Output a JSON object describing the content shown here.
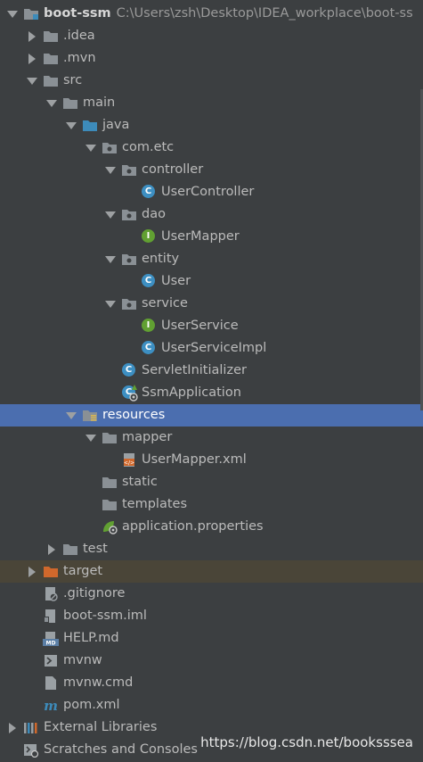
{
  "project": {
    "name": "boot-ssm",
    "path": "C:\\Users\\zsh\\Desktop\\IDEA_workplace\\boot-ss"
  },
  "tree": [
    {
      "label": "boot-ssm",
      "kind": "module-root",
      "depth": 0,
      "arrow": "down"
    },
    {
      "label": ".idea",
      "kind": "folder",
      "depth": 1,
      "arrow": "right"
    },
    {
      "label": ".mvn",
      "kind": "folder",
      "depth": 1,
      "arrow": "right"
    },
    {
      "label": "src",
      "kind": "folder",
      "depth": 1,
      "arrow": "down"
    },
    {
      "label": "main",
      "kind": "folder",
      "depth": 2,
      "arrow": "down"
    },
    {
      "label": "java",
      "kind": "source-folder",
      "depth": 3,
      "arrow": "down"
    },
    {
      "label": "com.etc",
      "kind": "package",
      "depth": 4,
      "arrow": "down"
    },
    {
      "label": "controller",
      "kind": "package",
      "depth": 5,
      "arrow": "down"
    },
    {
      "label": "UserController",
      "kind": "class",
      "depth": 6,
      "arrow": ""
    },
    {
      "label": "dao",
      "kind": "package",
      "depth": 5,
      "arrow": "down"
    },
    {
      "label": "UserMapper",
      "kind": "interface",
      "depth": 6,
      "arrow": ""
    },
    {
      "label": "entity",
      "kind": "package",
      "depth": 5,
      "arrow": "down"
    },
    {
      "label": "User",
      "kind": "class",
      "depth": 6,
      "arrow": ""
    },
    {
      "label": "service",
      "kind": "package",
      "depth": 5,
      "arrow": "down"
    },
    {
      "label": "UserService",
      "kind": "interface",
      "depth": 6,
      "arrow": ""
    },
    {
      "label": "UserServiceImpl",
      "kind": "class",
      "depth": 6,
      "arrow": ""
    },
    {
      "label": "ServletInitializer",
      "kind": "class",
      "depth": 5,
      "arrow": ""
    },
    {
      "label": "SsmApplication",
      "kind": "spring-class",
      "depth": 5,
      "arrow": ""
    },
    {
      "label": "resources",
      "kind": "resources-folder",
      "depth": 3,
      "arrow": "down",
      "selected": true
    },
    {
      "label": "mapper",
      "kind": "folder",
      "depth": 4,
      "arrow": "down"
    },
    {
      "label": "UserMapper.xml",
      "kind": "xml-file",
      "depth": 5,
      "arrow": ""
    },
    {
      "label": "static",
      "kind": "folder",
      "depth": 4,
      "arrow": ""
    },
    {
      "label": "templates",
      "kind": "folder",
      "depth": 4,
      "arrow": ""
    },
    {
      "label": "application.properties",
      "kind": "properties-file",
      "depth": 4,
      "arrow": ""
    },
    {
      "label": "test",
      "kind": "folder",
      "depth": 2,
      "arrow": "right"
    },
    {
      "label": "target",
      "kind": "excluded-folder",
      "depth": 1,
      "arrow": "right",
      "excluded": true
    },
    {
      "label": ".gitignore",
      "kind": "gitignore-file",
      "depth": 1,
      "arrow": ""
    },
    {
      "label": "boot-ssm.iml",
      "kind": "iml-file",
      "depth": 1,
      "arrow": ""
    },
    {
      "label": "HELP.md",
      "kind": "md-file",
      "depth": 1,
      "arrow": ""
    },
    {
      "label": "mvnw",
      "kind": "shell-file",
      "depth": 1,
      "arrow": ""
    },
    {
      "label": "mvnw.cmd",
      "kind": "text-file",
      "depth": 1,
      "arrow": ""
    },
    {
      "label": "pom.xml",
      "kind": "maven-file",
      "depth": 1,
      "arrow": ""
    },
    {
      "label": "External Libraries",
      "kind": "libraries",
      "depth": 0,
      "arrow": "right"
    },
    {
      "label": "Scratches and Consoles",
      "kind": "scratches",
      "depth": 0,
      "arrow": ""
    }
  ],
  "watermark": "https://blog.csdn.net/booksssea",
  "colors": {
    "background": "#3c3f41",
    "selection": "#4b6eaf",
    "excluded_row": "#4a4538",
    "folder": "#8a9095",
    "source_folder": "#3d8bba",
    "excluded_folder": "#d0682c",
    "class_icon": "#3d8fc2",
    "interface_icon": "#61a032"
  }
}
